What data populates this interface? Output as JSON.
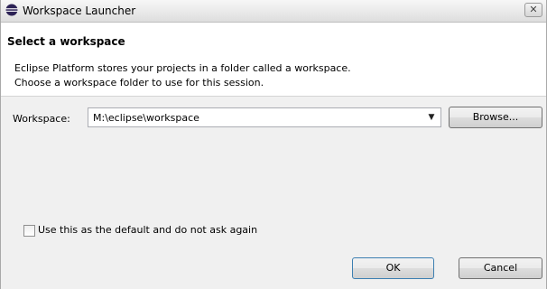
{
  "window": {
    "title": "Workspace Launcher",
    "close_glyph": "✕",
    "icons": {
      "app": "eclipse-icon",
      "close": "close-icon",
      "dropdown": "chevron-down-icon"
    }
  },
  "banner": {
    "title": "Select a workspace",
    "description_line1": "Eclipse Platform stores your projects in a folder called a workspace.",
    "description_line2": "Choose a workspace folder to use for this session."
  },
  "workspace": {
    "label": "Workspace:",
    "value": "M:\\eclipse\\workspace",
    "arrow_glyph": "▼",
    "browse_label": "Browse..."
  },
  "options": {
    "default_checkbox_label": "Use this as the default and do not ask again",
    "default_checked": false
  },
  "buttons": {
    "ok_label": "OK",
    "cancel_label": "Cancel"
  }
}
